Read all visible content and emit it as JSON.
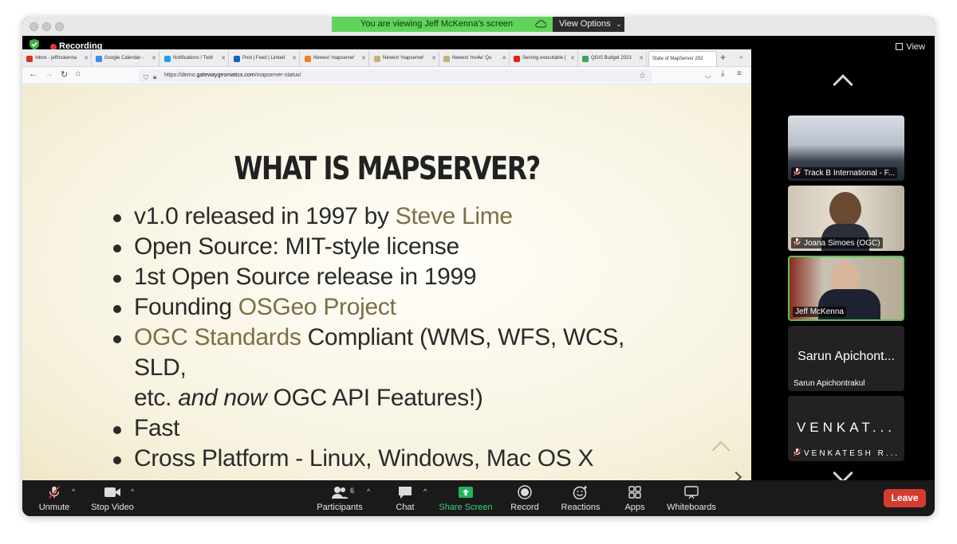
{
  "banner": {
    "text": "You are viewing Jeff McKenna's screen",
    "options_label": "View Options"
  },
  "top": {
    "recording_label": "Recording",
    "view_label": "View"
  },
  "browser": {
    "tabs": [
      {
        "label": "Inbox - jeffmckenna",
        "icon_color": "#d93025"
      },
      {
        "label": "Google Calendar - ",
        "icon_color": "#4285f4"
      },
      {
        "label": "Notifications / Twitt",
        "icon_color": "#1da1f2"
      },
      {
        "label": "Post | Feed | Linked",
        "icon_color": "#0a66c2"
      },
      {
        "label": "Newest 'mapserver'",
        "icon_color": "#f48024"
      },
      {
        "label": "Newest 'mapserver'",
        "icon_color": "#c5b07a"
      },
      {
        "label": "Newest 'ms4w' Qu",
        "icon_color": "#c5b07a"
      },
      {
        "label": "Serving executable (",
        "icon_color": "#e62117"
      },
      {
        "label": "QGIS Budget 2023",
        "icon_color": "#34a853"
      },
      {
        "label": "State of MapServer 202",
        "icon_color": "#ffffff"
      }
    ],
    "url_prefix": "https://demo.",
    "url_domain": "gatewaygeomatics.com",
    "url_path": "/mapserver-status/"
  },
  "slide": {
    "title": "WHAT IS MAPSERVER?",
    "b1_pre": "v1.0 released in 1997 by ",
    "b1_hl": "Steve Lime",
    "b2": "Open Source: MIT-style license",
    "b3": "1st Open Source release in 1999",
    "b4_pre": "Founding ",
    "b4_hl": "OSGeo Project",
    "b5_hl": "OGC Standards",
    "b5_post": " Compliant (WMS, WFS, WCS, SLD,",
    "b5_cont_pre": "etc. ",
    "b5_cont_it": "and now",
    "b5_cont_post": " OGC API Features!)",
    "b6": "Fast",
    "b7": "Cross Platform - Linux, Windows, Mac OS X"
  },
  "participants_panel": {
    "tiles": [
      {
        "name": "Track B International - F..."
      },
      {
        "name": "Joana Simoes (OGC)"
      },
      {
        "name": "Jeff McKenna"
      },
      {
        "big": "Sarun Apichont...",
        "name": "Sarun Apichontrakul"
      },
      {
        "big": "VENKAT...",
        "name": "VENKATESH R..."
      }
    ]
  },
  "toolbar": {
    "unmute": "Unmute",
    "stop_video": "Stop Video",
    "participants": "Participants",
    "participants_count": "6",
    "chat": "Chat",
    "share_screen": "Share Screen",
    "record": "Record",
    "reactions": "Reactions",
    "apps": "Apps",
    "whiteboards": "Whiteboards",
    "leave": "Leave"
  },
  "colors": {
    "share_green": "#5fd35a",
    "leave_red": "#d63b30",
    "slide_highlight": "#7b6f45",
    "active_speaker": "#5dc24f"
  }
}
